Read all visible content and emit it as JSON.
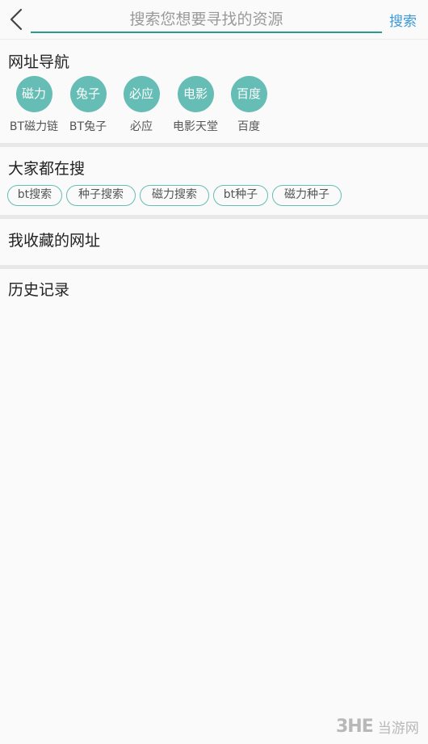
{
  "search": {
    "value": "",
    "placeholder": "搜索您想要寻找的资源",
    "button_label": "搜索"
  },
  "nav": {
    "title": "网址导航",
    "items": [
      {
        "circle": "磁力",
        "label": "BT磁力链"
      },
      {
        "circle": "兔子",
        "label": "BT兔子"
      },
      {
        "circle": "必应",
        "label": "必应"
      },
      {
        "circle": "电影",
        "label": "电影天堂"
      },
      {
        "circle": "百度",
        "label": "百度"
      }
    ]
  },
  "hot": {
    "title": "大家都在搜",
    "tags": [
      "bt搜索",
      "种子搜索",
      "磁力搜索",
      "bt种子",
      "磁力种子"
    ]
  },
  "favorites": {
    "title": "我收藏的网址"
  },
  "history": {
    "title": "历史记录"
  },
  "watermark": {
    "mark": "3HE",
    "text": "当游网"
  },
  "colors": {
    "accent": "#66bdb5",
    "underline": "#2a9d8f",
    "link": "#3a9ad9"
  }
}
